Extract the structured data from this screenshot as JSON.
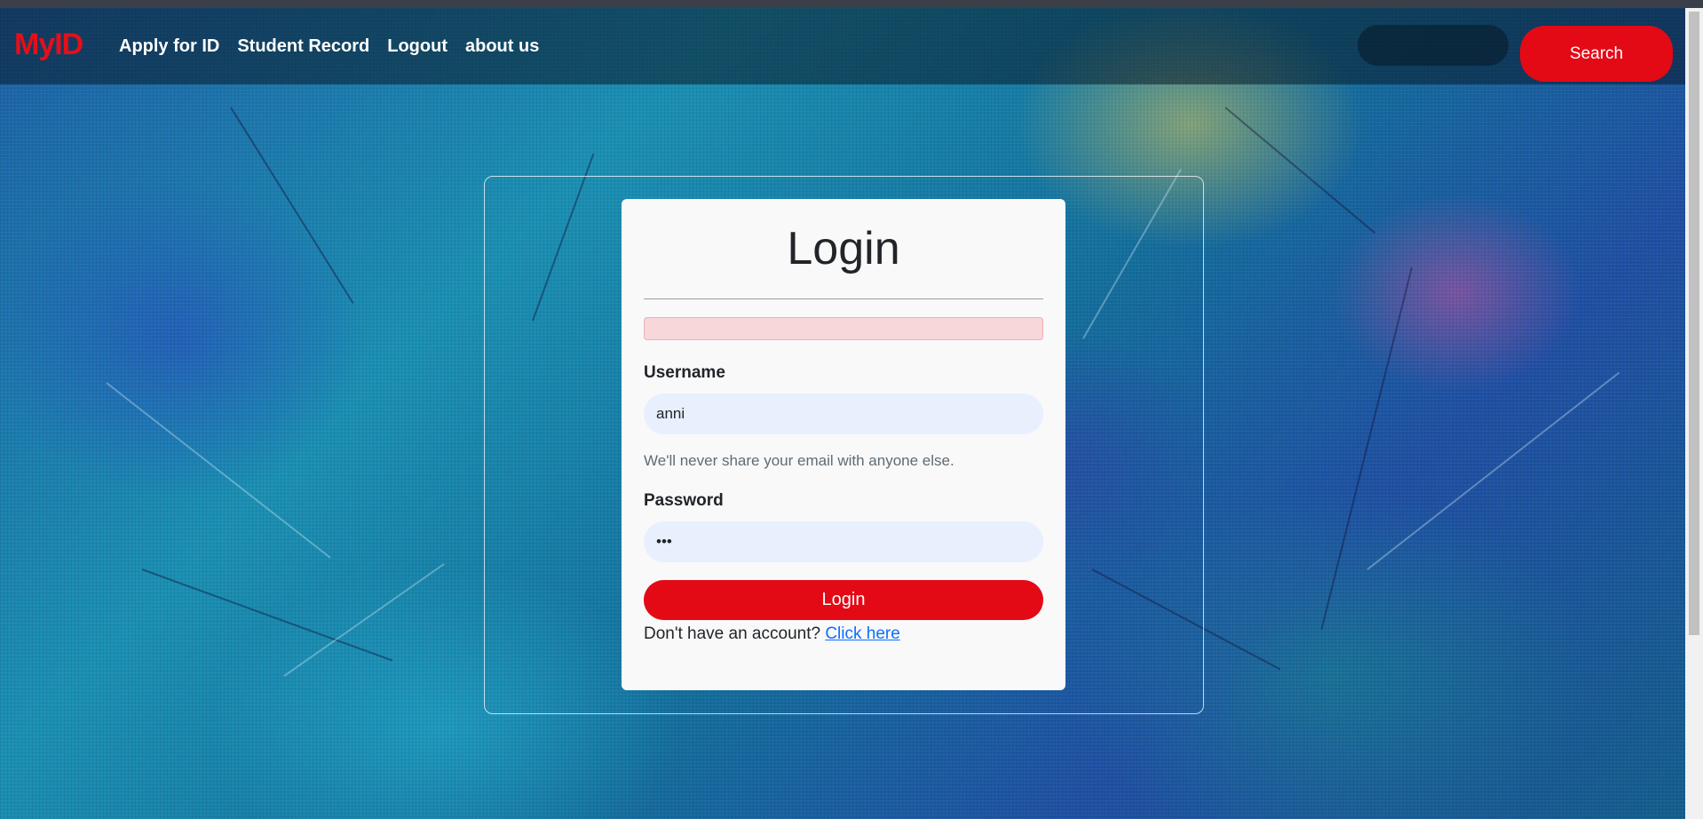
{
  "navbar": {
    "brand": "MyID",
    "links": [
      "Apply for ID",
      "Student Record",
      "Logout",
      "about us"
    ],
    "search_placeholder": "",
    "search_button": "Search"
  },
  "login": {
    "title": "Login",
    "alert_text": "",
    "username_label": "Username",
    "username_value": "anni",
    "help_text": "We'll never share your email with anyone else.",
    "password_label": "Password",
    "password_value": "...",
    "submit_label": "Login",
    "signup_prompt": "Don't have an account?",
    "signup_link": "Click here"
  },
  "colors": {
    "accent": "#e30a16",
    "input_bg": "#e8f0fe",
    "alert_bg": "#f8d7da",
    "link": "#0d6efd"
  }
}
